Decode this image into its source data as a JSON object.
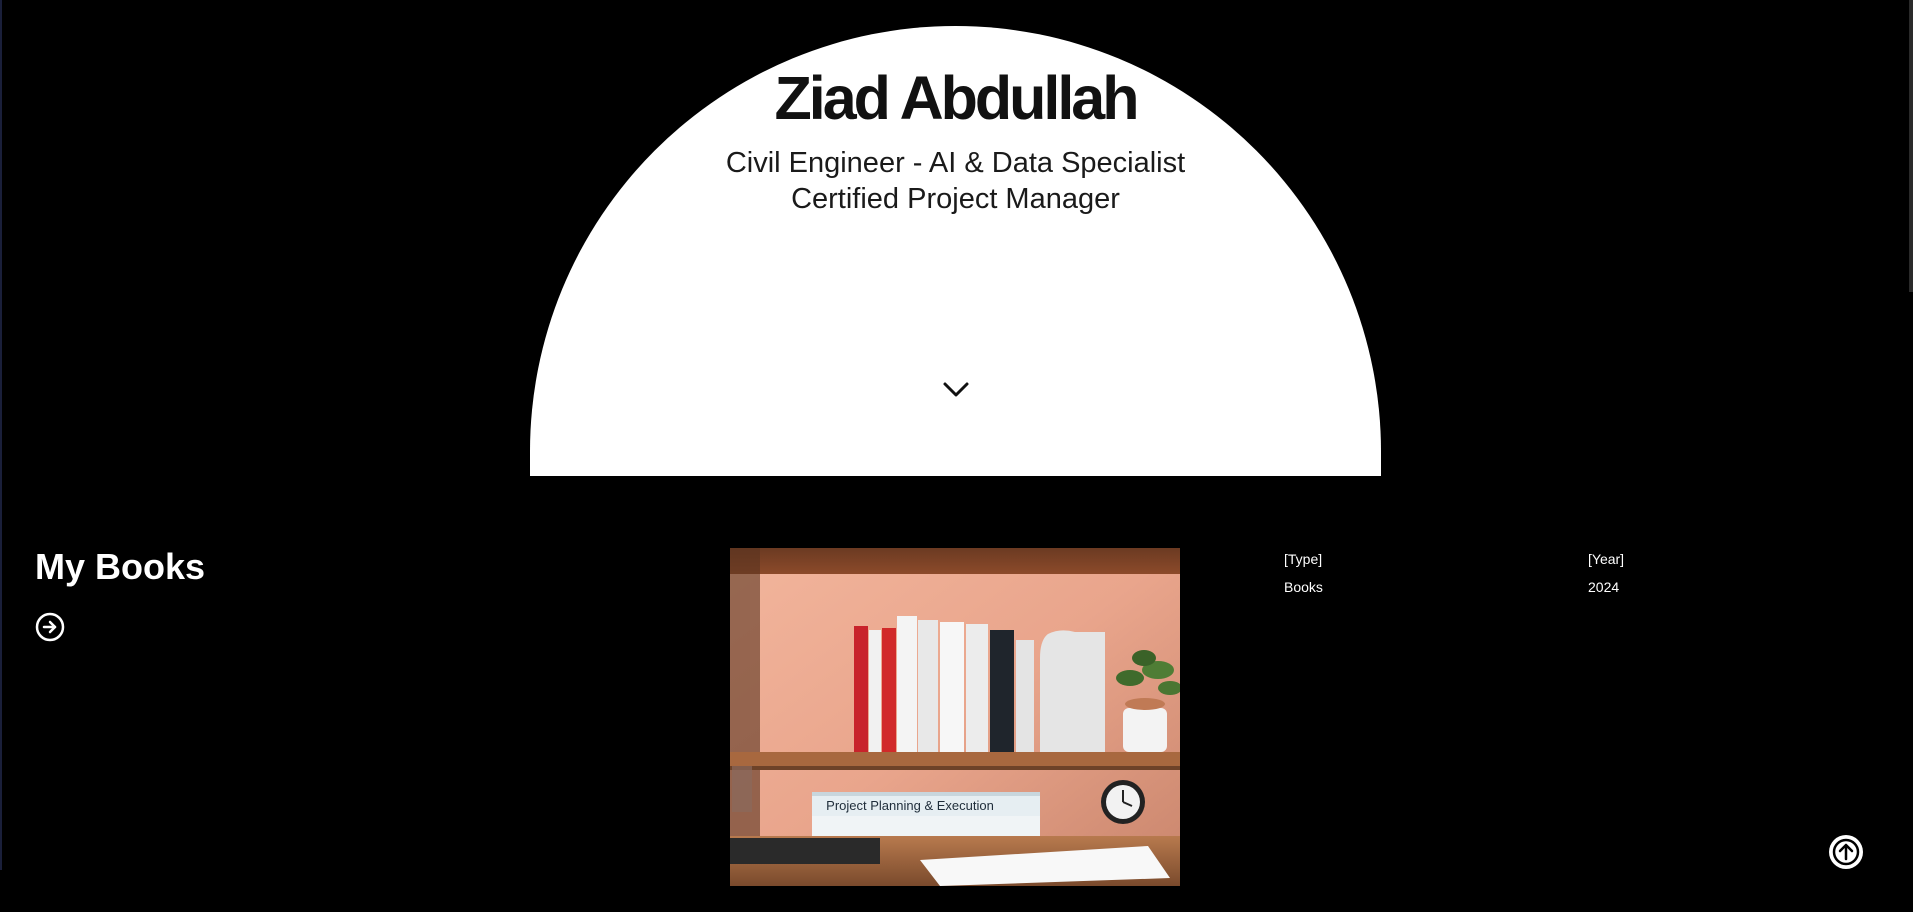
{
  "hero": {
    "name": "Ziad Abdullah",
    "subtitle_line1": "Civil Engineer - AI & Data Specialist",
    "subtitle_line2": "Certified Project Manager",
    "scroll_icon": "chevron-down-icon"
  },
  "books_section": {
    "title": "My Books",
    "arrow_icon": "arrow-right-circle-icon",
    "image_alt": "Bookshelf with project management books",
    "book_covers": {
      "stack_top": "Project Planning & Execution"
    },
    "meta": {
      "type_label": "[Type]",
      "type_value": "Books",
      "year_label": "[Year]",
      "year_value": "2024"
    }
  },
  "back_to_top_icon": "arrow-up-circle-icon",
  "colors": {
    "background": "#000000",
    "hero_bg": "#ffffff",
    "hero_text": "#111111",
    "text_light": "#ffffff"
  }
}
